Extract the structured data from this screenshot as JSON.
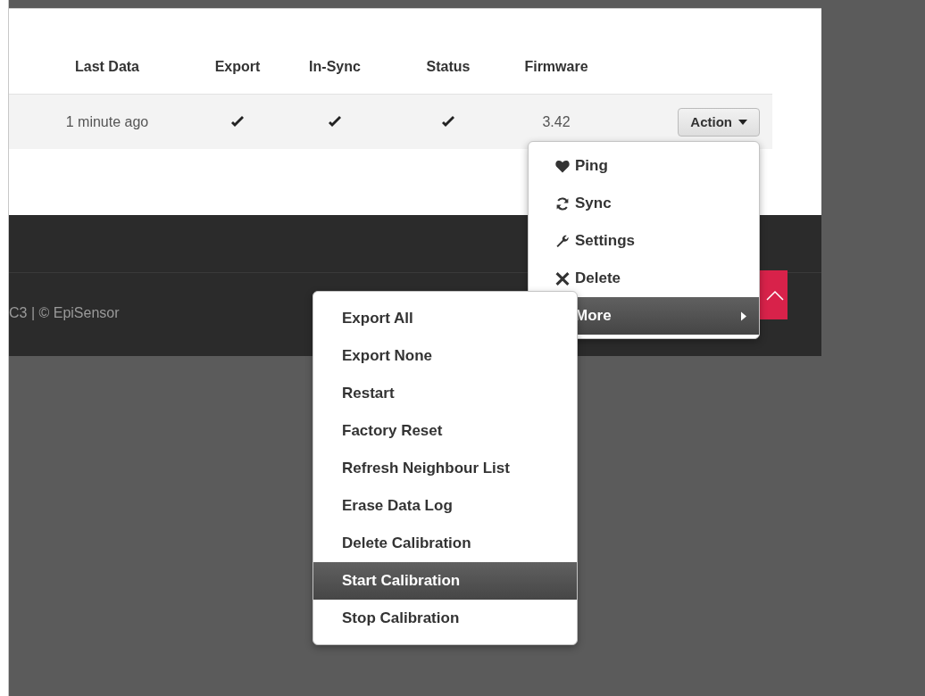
{
  "table": {
    "columns": [
      "Last Data",
      "Export",
      "In-Sync",
      "Status",
      "Firmware"
    ],
    "rows": [
      {
        "last_data": "1 minute ago",
        "export": true,
        "in_sync": true,
        "status": true,
        "firmware": "3.42",
        "action": "Action"
      }
    ]
  },
  "action_menu": {
    "items": [
      {
        "label": "Ping",
        "selected": false,
        "has_submenu": false
      },
      {
        "label": "Sync",
        "selected": false,
        "has_submenu": false
      },
      {
        "label": "Settings",
        "selected": false,
        "has_submenu": false
      },
      {
        "label": "Delete",
        "selected": false,
        "has_submenu": false
      },
      {
        "label": "More",
        "selected": true,
        "has_submenu": true
      }
    ]
  },
  "more_menu": {
    "items": [
      {
        "label": "Export All",
        "selected": false
      },
      {
        "label": "Export None",
        "selected": false
      },
      {
        "label": "Restart",
        "selected": false
      },
      {
        "label": "Factory Reset",
        "selected": false
      },
      {
        "label": "Refresh Neighbour List",
        "selected": false
      },
      {
        "label": "Erase Data Log",
        "selected": false
      },
      {
        "label": "Delete Calibration",
        "selected": false
      },
      {
        "label": "Start Calibration",
        "selected": true
      },
      {
        "label": "Stop Calibration",
        "selected": false
      }
    ]
  },
  "footer": {
    "text": "C3 | © EpiSensor"
  }
}
